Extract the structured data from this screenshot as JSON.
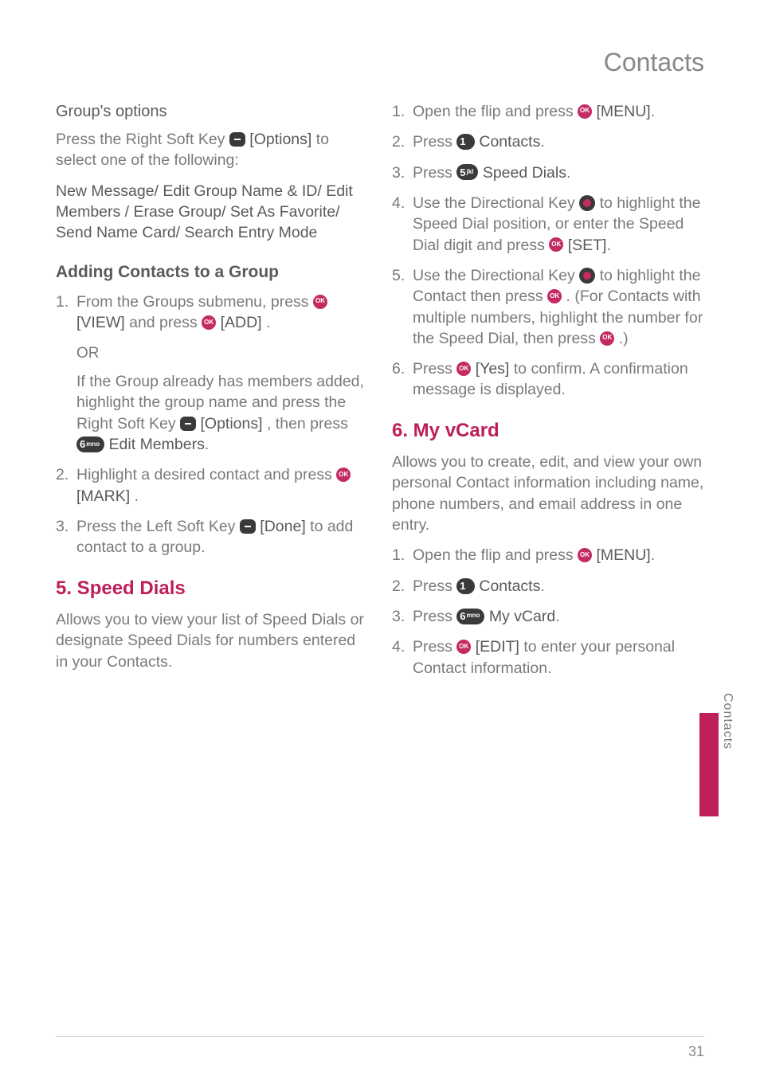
{
  "header": "Contacts",
  "left": {
    "groupOptionsTitle": "Group's options",
    "groupOptionsLine1a": "Press the Right Soft Key ",
    "groupOptionsLine1b": " [Options]",
    "groupOptionsLine1c": " to select one of the following:",
    "groupOptionsList": "New Message/ Edit Group Name & ID/ Edit Members / Erase Group/ Set As Favorite/ Send Name Card/ Search Entry Mode",
    "addingTitle": "Adding Contacts to a Group",
    "step1_n": "1.",
    "step1a": "From the Groups submenu, press ",
    "step1b": " [VIEW]",
    "step1c": " and press ",
    "step1d": " [ADD]",
    "step1e": ".",
    "or": "OR",
    "orPara_a": "If the Group already has members added, highlight the group name and press the Right Soft Key ",
    "orPara_b": " [Options]",
    "orPara_c": ", then press ",
    "orPara_d": "Edit Members",
    "orPara_e": ".",
    "key6": "6",
    "key6sm": "mno",
    "step2_n": "2.",
    "step2a": "Highlight a desired contact and press ",
    "step2b": " [MARK]",
    "step2c": ".",
    "step3_n": "3.",
    "step3a": "Press the Left Soft Key ",
    "step3b": " [Done]",
    "step3c": " to add contact to a group.",
    "speedDialsTitle": "5. Speed Dials",
    "speedDialsPara": "Allows you to view your list of Speed Dials or designate Speed Dials for numbers entered in your Contacts."
  },
  "right": {
    "r1_n": "1.",
    "r1a": "Open the flip and press ",
    "r1b": " [MENU]",
    "r1c": ".",
    "r2_n": "2.",
    "r2a": "Press ",
    "r2key": "1",
    "r2keysm": "",
    "r2b": "Contacts",
    "r2c": ".",
    "r3_n": "3.",
    "r3a": "Press ",
    "r3key": "5",
    "r3keysm": "jkl",
    "r3b": "Speed Dials",
    "r3c": ".",
    "r4_n": "4.",
    "r4a": "Use the Directional Key ",
    "r4b": " to highlight the Speed Dial position, or enter the Speed Dial digit and press ",
    "r4c": " [SET]",
    "r4d": ".",
    "r5_n": "5.",
    "r5a": "Use the Directional Key ",
    "r5b": " to highlight the Contact then press ",
    "r5c": ". (For Contacts with multiple numbers, highlight the number for the Speed Dial, then press ",
    "r5d": ".)",
    "r6_n": "6.",
    "r6a": "Press ",
    "r6b": " [Yes]",
    "r6c": " to confirm. A confirmation message is displayed.",
    "vcardTitle": "6. My vCard",
    "vcardPara": "Allows you to create, edit, and view your own personal Contact information including name, phone numbers, and email address in one entry.",
    "v1_n": "1.",
    "v1a": "Open the flip and press ",
    "v1b": " [MENU]",
    "v1c": ".",
    "v2_n": "2.",
    "v2a": "Press ",
    "v2key": "1",
    "v2keysm": "",
    "v2b": "Contacts",
    "v2c": ".",
    "v3_n": "3.",
    "v3a": "Press ",
    "v3key": "6",
    "v3keysm": "mno",
    "v3b": "My vCard",
    "v3c": ".",
    "v4_n": "4.",
    "v4a": "Press ",
    "v4b": " [EDIT]",
    "v4c": " to enter your personal Contact information."
  },
  "tabLabel": "Contacts",
  "pageNumber": "31"
}
